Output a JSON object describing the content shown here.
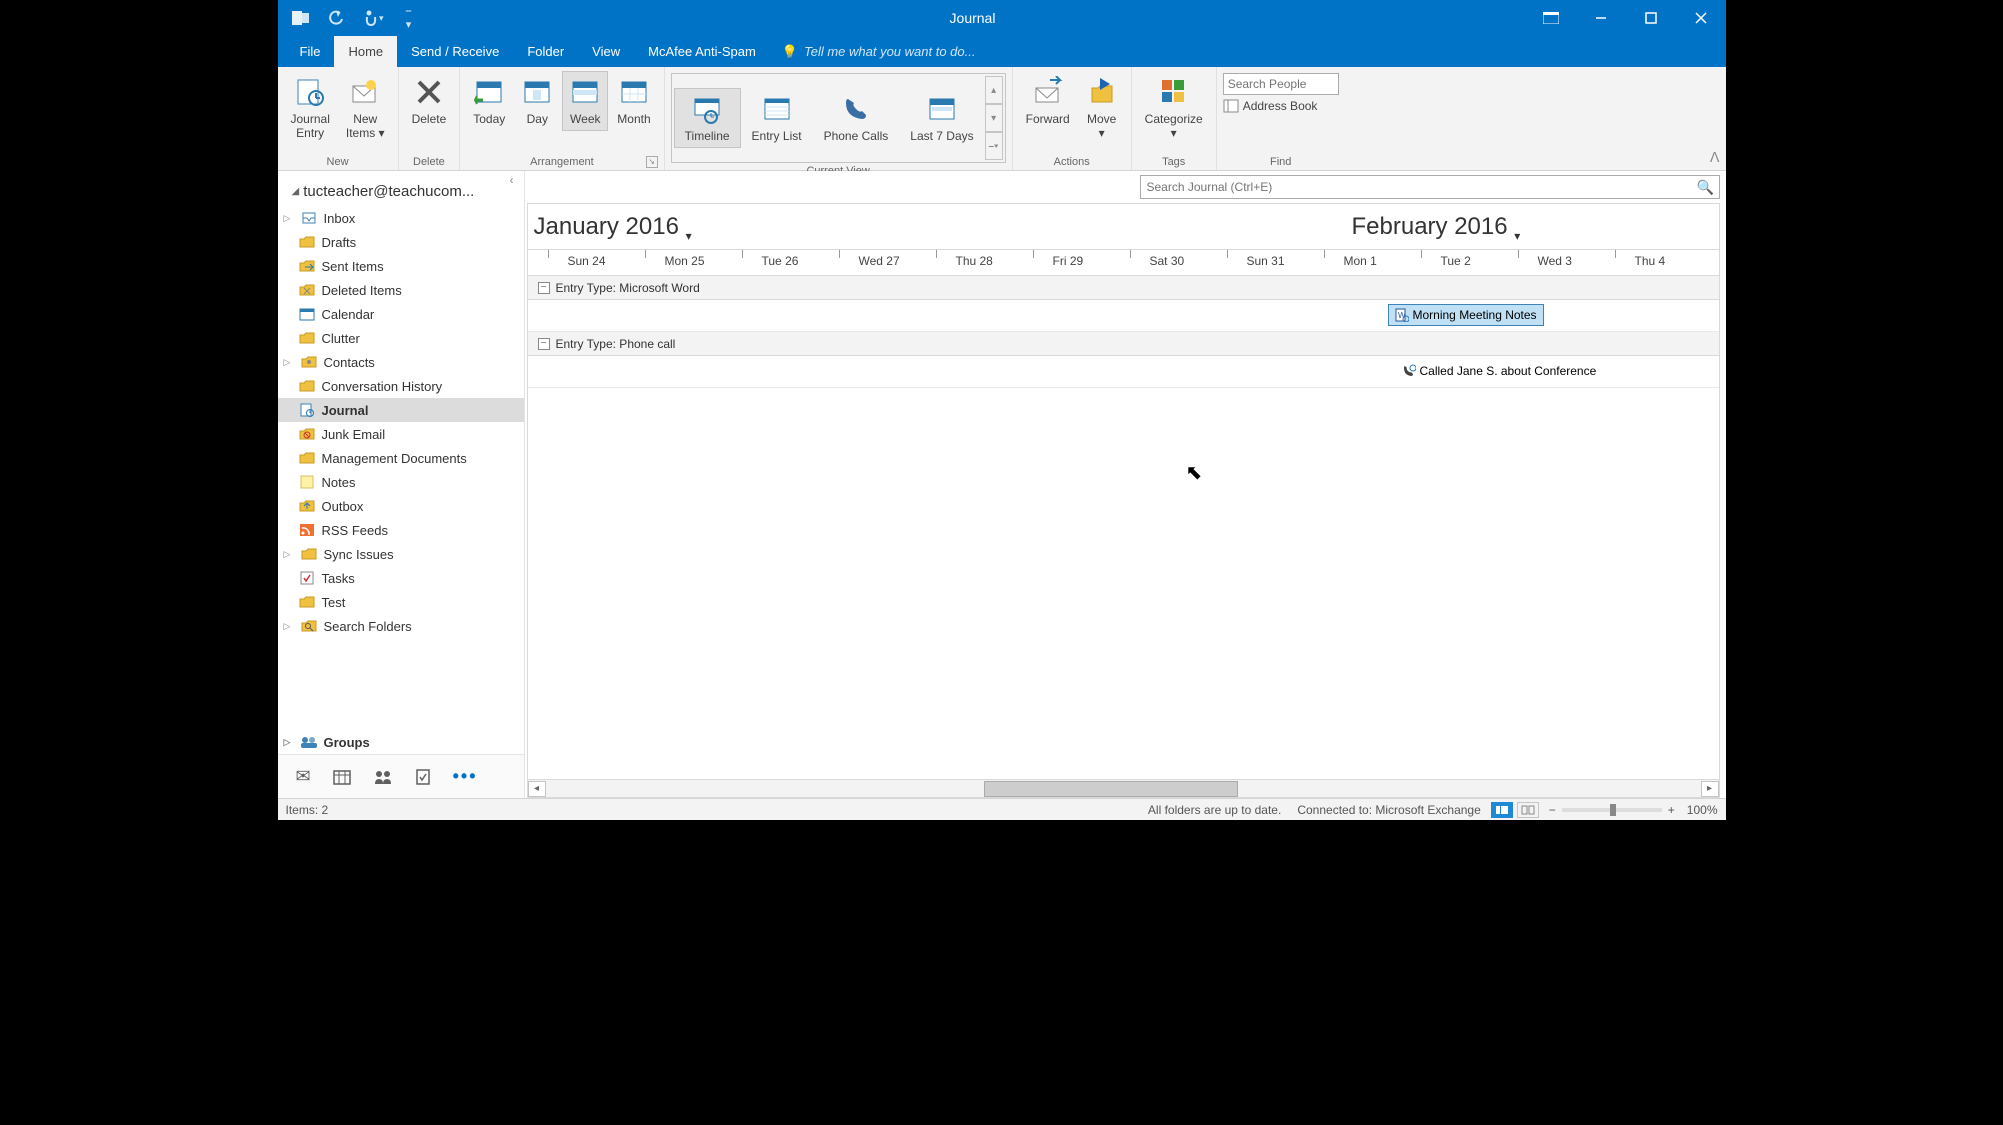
{
  "title": "Journal",
  "tabs": {
    "file": "File",
    "home": "Home",
    "sendreceive": "Send / Receive",
    "folder": "Folder",
    "view": "View",
    "mcafee": "McAfee Anti-Spam"
  },
  "tellme": "Tell me what you want to do...",
  "ribbon": {
    "new": {
      "journal_entry": "Journal\nEntry",
      "new_items": "New\nItems",
      "label": "New"
    },
    "delete": {
      "delete": "Delete",
      "label": "Delete"
    },
    "arrangement": {
      "today": "Today",
      "day": "Day",
      "week": "Week",
      "month": "Month",
      "label": "Arrangement"
    },
    "current_view": {
      "timeline": "Timeline",
      "entry_list": "Entry List",
      "phone_calls": "Phone Calls",
      "last7": "Last 7 Days",
      "label": "Current View"
    },
    "actions": {
      "forward": "Forward",
      "move": "Move",
      "label": "Actions"
    },
    "tags": {
      "categorize": "Categorize",
      "label": "Tags"
    },
    "find": {
      "search_placeholder": "Search People",
      "address_book": "Address Book",
      "label": "Find"
    }
  },
  "account": "tucteacher@teachucom...",
  "folders": [
    {
      "name": "Inbox",
      "expandable": true,
      "icon": "inbox"
    },
    {
      "name": "Drafts",
      "icon": "folder"
    },
    {
      "name": "Sent Items",
      "icon": "sent"
    },
    {
      "name": "Deleted Items",
      "icon": "trash"
    },
    {
      "name": "Calendar",
      "icon": "calendar"
    },
    {
      "name": "Clutter",
      "icon": "folder"
    },
    {
      "name": "Contacts",
      "expandable": true,
      "icon": "contacts"
    },
    {
      "name": "Conversation History",
      "icon": "folder"
    },
    {
      "name": "Journal",
      "icon": "journal",
      "selected": true
    },
    {
      "name": "Junk Email",
      "icon": "junk"
    },
    {
      "name": "Management Documents",
      "icon": "folder"
    },
    {
      "name": "Notes",
      "icon": "notes"
    },
    {
      "name": "Outbox",
      "icon": "outbox"
    },
    {
      "name": "RSS Feeds",
      "icon": "rss"
    },
    {
      "name": "Sync Issues",
      "expandable": true,
      "icon": "folder"
    },
    {
      "name": "Tasks",
      "icon": "tasks"
    },
    {
      "name": "Test",
      "icon": "folder"
    },
    {
      "name": "Search Folders",
      "expandable": true,
      "icon": "search"
    }
  ],
  "groups_label": "Groups",
  "search_journal_placeholder": "Search Journal (Ctrl+E)",
  "months": {
    "m1": "January 2016",
    "m2": "February 2016"
  },
  "days": [
    "Sun 24",
    "Mon 25",
    "Tue 26",
    "Wed 27",
    "Thu 28",
    "Fri 29",
    "Sat 30",
    "Sun 31",
    "Mon 1",
    "Tue 2",
    "Wed 3",
    "Thu 4"
  ],
  "entry_types": {
    "word": "Entry Type: Microsoft Word",
    "phone": "Entry Type: Phone call"
  },
  "entries": {
    "word": "Morning Meeting Notes",
    "phone": "Called Jane S. about Conference"
  },
  "status": {
    "items": "Items: 2",
    "sync": "All folders are up to date.",
    "conn": "Connected to: Microsoft Exchange",
    "zoom": "100%"
  }
}
